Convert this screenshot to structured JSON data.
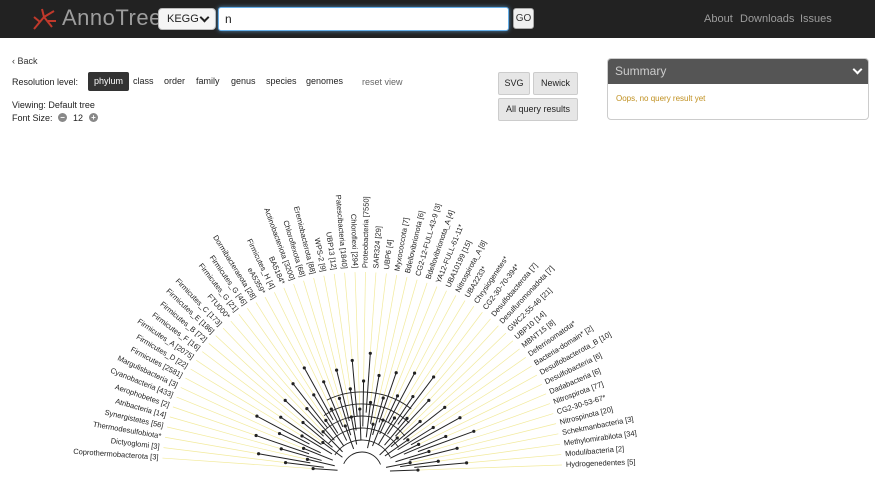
{
  "header": {
    "brand": "AnnoTree",
    "db_select": "KEGG",
    "search_value": "n",
    "go_label": "GO",
    "nav": [
      "About",
      "Downloads",
      "Issues"
    ]
  },
  "controls": {
    "back": "Back",
    "resolution_label": "Resolution level:",
    "levels": [
      "phylum",
      "class",
      "order",
      "family",
      "genus",
      "species",
      "genomes"
    ],
    "active_level": "phylum",
    "reset": "reset view",
    "viewing": "Viewing: Default tree",
    "font_size_label": "Font Size:",
    "font_size": "12",
    "svg_label": "SVG",
    "newick_label": "Newick",
    "all_results_label": "All query results"
  },
  "summary": {
    "title": "Summary",
    "message": "Oops, no query result yet"
  },
  "tree": {
    "leaf_labels": [
      "Coprothermobacterota [3]",
      "Dictyoglomi [3]",
      "Thermodesulfobiota*",
      "Synergistetes [56]",
      "Atribacteria [14]",
      "Aerophobetes [2]",
      "Cyanobacteria [433]",
      "Margulisbacteria [3]",
      "Firmicutes [2581]",
      "Firmicutes_D [22]",
      "Firmicutes_A [2075]",
      "Firmicutes_F [16]",
      "Firmicutes_B [72]",
      "Firmicutes_E [186]",
      "Firmicutes_C [173]",
      "FTU000*",
      "Firmicutes_G [21]",
      "Firmicutes_G [46]",
      "Dormibacteraeota [28]",
      "eA5359*",
      "Firmicutes_H [4]",
      "BA5184*",
      "Actinobacteriota [3200]",
      "Chloroflexota [68]",
      "Eremiobacterota [88]",
      "WPS-2 [9]",
      "UBP13 [12]",
      "Patescibacteria [1840]",
      "Chloroflexi [294]",
      "Proteobacteria [7550]",
      "SAR324 [29]",
      "UBP6 [4]",
      "Myxococcota [7]",
      "Bdellovibrionota [6]",
      "CG2-12-FULL-43-9 [3]",
      "Bdellovibrionota_A [4]",
      "YA12-FULL-61-11*",
      "UBA10199 [15]",
      "Nitrospirota_A [8]",
      "UBA2233*",
      "Chrysiogenetes*",
      "CG2-30-70-394*",
      "Desulfobacterota [7]",
      "Desulfuromonadota [7]",
      "GWC2-55-46 [21]",
      "UBP10 [14]",
      "MBNT15 [8]",
      "Deferrisomatota*",
      "Bacteria-domain* [2]",
      "Desulfobacterota_B [10]",
      "Desulfobacteria [6]",
      "Dadabacteria [6]",
      "Nitrospirota [77]",
      "CG2-30-53-67*",
      "Nitrospinota [20]",
      "Schekmanbacteria [3]",
      "Methylomirabilota [34]",
      "Modulibacteria [2]",
      "Hydrogenedentes [5]"
    ]
  }
}
